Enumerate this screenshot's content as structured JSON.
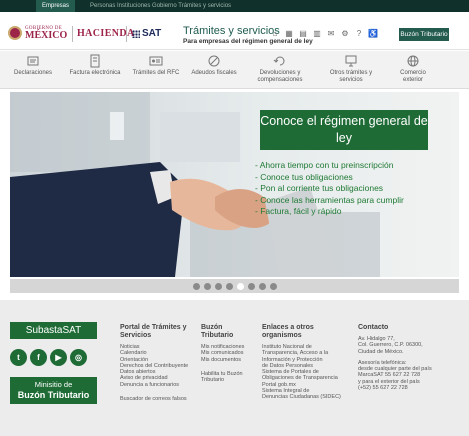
{
  "topbar": {
    "active_tab": "Empresas",
    "rest": "Personas   Instituciones   Gobierno   Trámites y servicios"
  },
  "header": {
    "gob_line1": "GOBIERNO DE",
    "gob_line2": "MÉXICO",
    "hacienda": "HACIENDA",
    "sat": "SAT",
    "title": "Trámites y servicios",
    "subtitle": "Para empresas del régimen general de ley",
    "buzon_button": "Buzón Tributario",
    "icons": [
      "home-icon",
      "calendar-icon",
      "document-icon",
      "grid-icon",
      "mail-icon",
      "settings-icon",
      "help-icon",
      "accessibility-icon"
    ]
  },
  "nav": [
    {
      "label": "Declaraciones",
      "icon": "declaraciones-icon"
    },
    {
      "label": "Factura electrónica",
      "icon": "factura-icon"
    },
    {
      "label": "Trámites del RFC",
      "icon": "rfc-icon"
    },
    {
      "label": "Adeudos fiscales",
      "icon": "adeudos-icon"
    },
    {
      "label": "Devoluciones y compensaciones",
      "icon": "devoluciones-icon"
    },
    {
      "label": "Otros trámites y servicios",
      "icon": "otros-tramites-icon"
    },
    {
      "label": "Comercio exterior",
      "icon": "comercio-exterior-icon"
    }
  ],
  "hero": {
    "headline": "Conoce el régimen general de ley",
    "bullets": [
      "- Ahorra tiempo con tu preinscripción",
      "- Conoce tus obligaciones",
      "- Pon al corriente tus obligaciones",
      "- Conoce las herramientas para cumplir",
      "- Factura, fácil y rápido"
    ],
    "dots_count": 8,
    "active_dot": 4
  },
  "footer": {
    "subasta": "SubastaSAT",
    "social": [
      "twitter-icon",
      "facebook-icon",
      "youtube-icon",
      "instagram-icon"
    ],
    "minisitio_line1": "Minisitio de",
    "minisitio_line2": "Buzón Tributario",
    "col1": {
      "title": "Portal de Trámites y Servicios",
      "links": [
        "Noticias",
        "Calendario",
        "Orientación",
        "Derechos del Contribuyente",
        "Datos abiertos",
        "Aviso de privacidad",
        "Denuncia a funcionarios"
      ],
      "extra": "Buscador de correos falsos"
    },
    "col2": {
      "title": "Buzón Tributario",
      "links": [
        "Mis notificaciones",
        "Mis comunicados",
        "Mis documentos"
      ],
      "extra": [
        "Habilita tu Buzón",
        "Tributario"
      ]
    },
    "col3": {
      "title": "Enlaces a otros organismos",
      "links": [
        "Instituto Nacional de",
        "Transparencia, Acceso a la",
        "Información y Protección",
        "de Datos Personales",
        "Sistema de Portales de",
        "Obligaciones de Transparencia",
        "Portal gob.mx",
        "Sistema Integral de",
        "Denuncias Ciudadanas (SIDEC)"
      ]
    },
    "col4": {
      "title": "Contacto",
      "address": [
        "Av. Hidalgo 77,",
        "Col. Guerrero, C.P. 06300,",
        "Ciudad de México."
      ],
      "phone": [
        "Asesoría telefónica:",
        "desde cualquier parte del país",
        "MarcaSAT 55 627 22 728",
        "y para el exterior del país",
        "(+52) 55 627 22 728"
      ]
    }
  }
}
